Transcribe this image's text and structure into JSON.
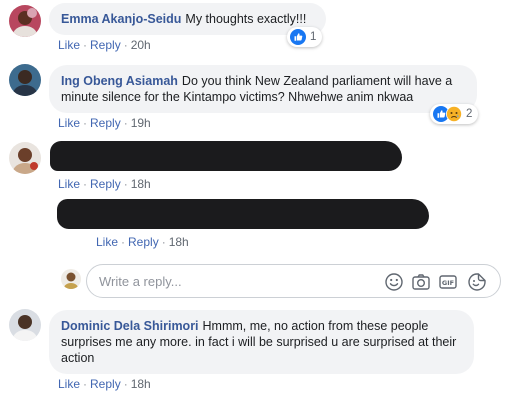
{
  "comments": [
    {
      "author": "Emma Akanjo-Seidu",
      "text": "My thoughts exactly!!!",
      "like_label": "Like",
      "reply_label": "Reply",
      "time": "20h",
      "reaction_count": "1"
    },
    {
      "author": "Ing Obeng Asiamah",
      "text": "Do you think New Zealand parliament will have a minute silence for the Kintampo victims? Nhwehwe anim nkwaa",
      "like_label": "Like",
      "reply_label": "Reply",
      "time": "19h",
      "reaction_count": "2"
    },
    {
      "author": "",
      "text": "",
      "like_label": "Like",
      "reply_label": "Reply",
      "time": "18h"
    },
    {
      "author": "Dominic Dela Shirimori",
      "text": "Hmmm, me, no action from these people surprises me any more. in fact i will be surprised u are surprised at their action",
      "like_label": "Like",
      "reply_label": "Reply",
      "time": "18h"
    }
  ],
  "reply": {
    "like_label": "Like",
    "reply_label": "Reply",
    "time": "18h"
  },
  "reply_box": {
    "placeholder": "Write a reply..."
  },
  "icons": [
    "emoji-icon",
    "camera-icon",
    "gif-icon",
    "sticker-icon",
    "like-reaction-icon",
    "sad-reaction-icon"
  ],
  "colors": {
    "name_link": "#385898",
    "action_link": "#4267b2",
    "bubble_bg": "#f2f3f5",
    "muted_text": "#606770"
  }
}
